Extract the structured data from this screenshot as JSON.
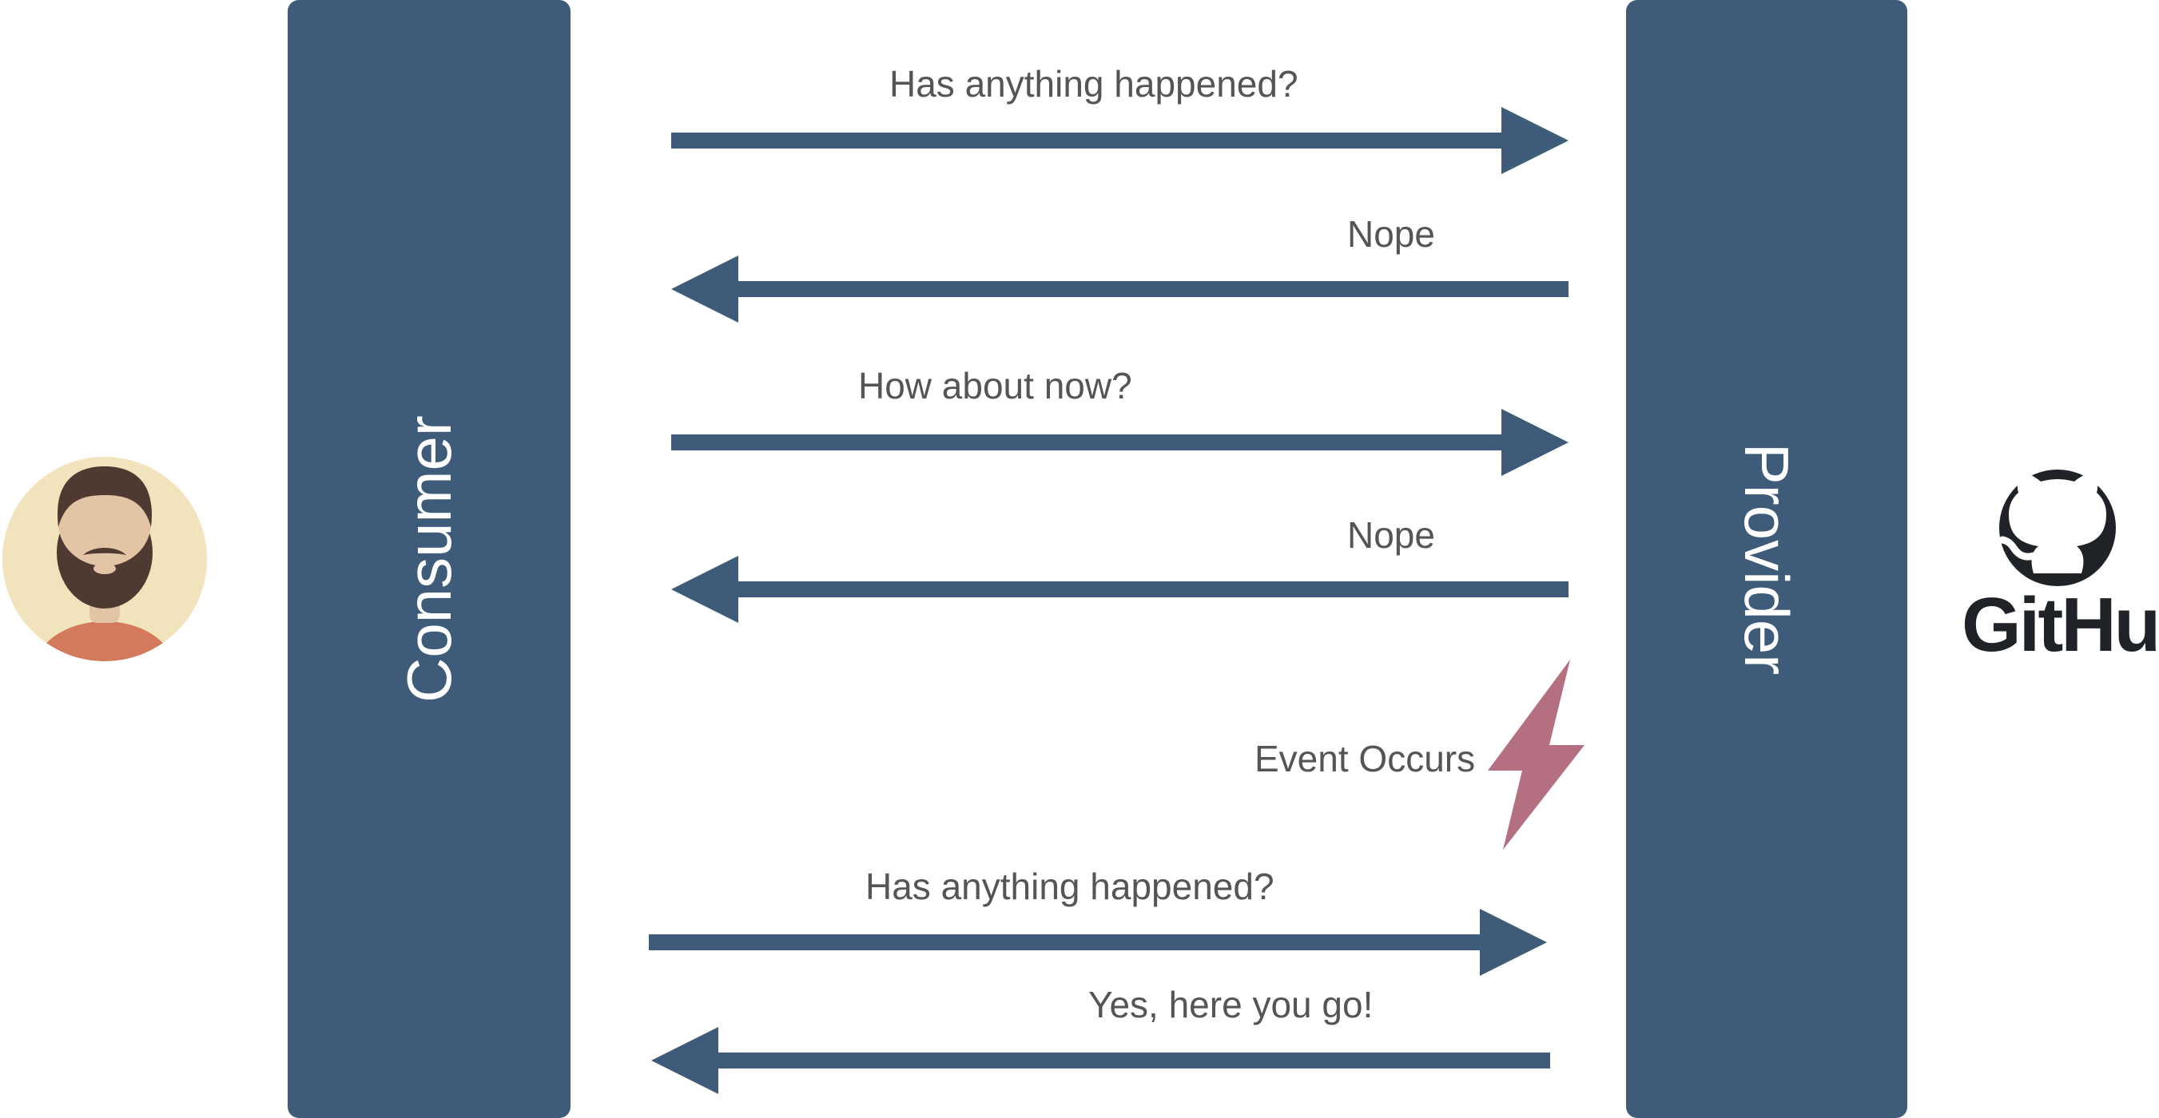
{
  "colors": {
    "bar": "#3f5b7a",
    "arrow": "#3f5b7a",
    "text": "#555555",
    "bolt": "#b46f80",
    "avatar_bg": "#f1e4bd",
    "skin": "#e3c4a4",
    "hair": "#4f3a31",
    "shirt": "#d47a5c",
    "github": "#1f2328"
  },
  "actors": {
    "consumer": {
      "label": "Consumer",
      "icon": "user-avatar-icon"
    },
    "provider": {
      "label": "Provider",
      "icon": "github-octocat-icon",
      "logo_text": "GitHub"
    }
  },
  "messages": [
    {
      "text": "Has anything happened?",
      "direction": "to-provider"
    },
    {
      "text": "Nope",
      "direction": "to-consumer"
    },
    {
      "text": "How about now?",
      "direction": "to-provider"
    },
    {
      "text": "Nope",
      "direction": "to-consumer"
    },
    {
      "text": "Has anything happened?",
      "direction": "to-provider"
    },
    {
      "text": "Yes, here you go!",
      "direction": "to-consumer"
    }
  ],
  "event": {
    "text": "Event Occurs",
    "icon": "lightning-bolt-icon"
  }
}
